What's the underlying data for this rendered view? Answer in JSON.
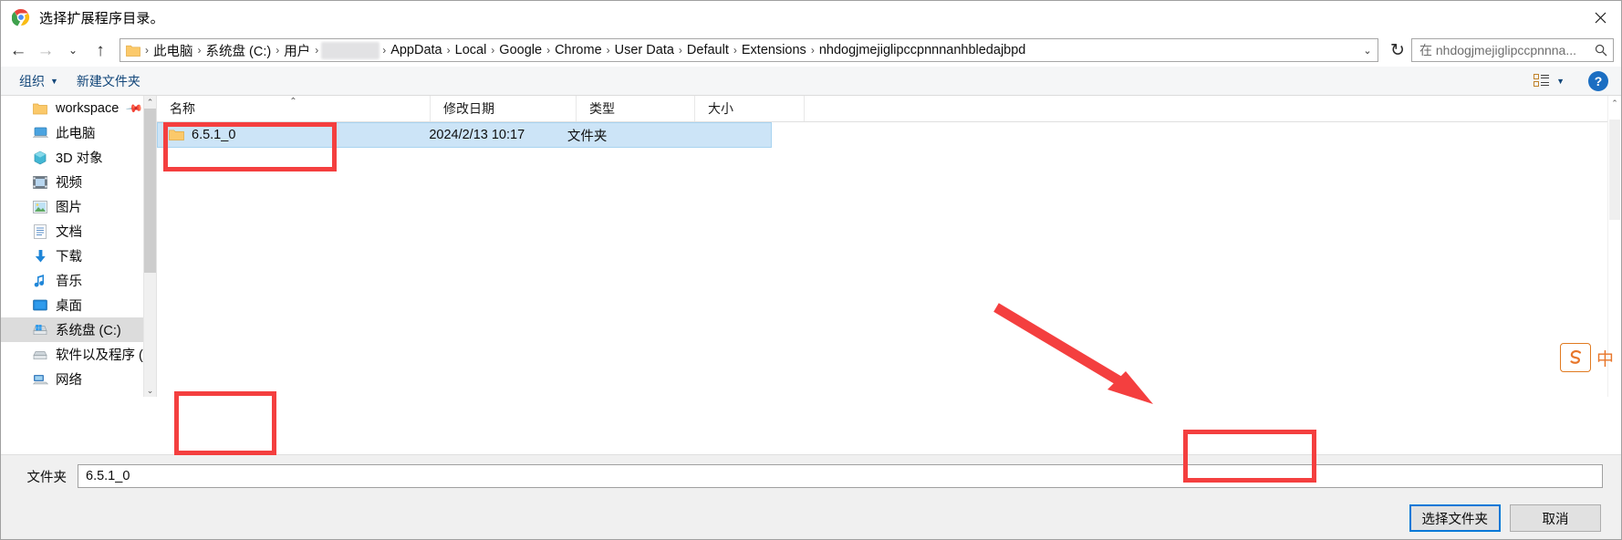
{
  "window": {
    "title": "选择扩展程序目录。",
    "app_icon": "chrome-icon",
    "close_label": "✕"
  },
  "nav": {
    "back": "←",
    "forward": "→",
    "recent": "⌄",
    "up": "↑",
    "breadcrumbs": [
      "此电脑",
      "系统盘 (C:)",
      "用户",
      "",
      "AppData",
      "Local",
      "Google",
      "Chrome",
      "User Data",
      "Default",
      "Extensions",
      "nhdogjmejiglipccpnnnanhbledajbpd"
    ],
    "dropdown": "⌄",
    "refresh": "↻",
    "search_placeholder": "在 nhdogjmejiglipccpnnna..."
  },
  "toolbar": {
    "organize": "组织",
    "organize_caret": "▼",
    "new_folder": "新建文件夹",
    "view_caret": "▼",
    "help": "?"
  },
  "sidebar": {
    "items": [
      {
        "label": "workspace",
        "icon": "folder-icon",
        "pinned": true,
        "selected": false
      },
      {
        "label": "此电脑",
        "icon": "this-pc-icon",
        "pinned": false,
        "selected": false
      },
      {
        "label": "3D 对象",
        "icon": "3d-objects-icon",
        "pinned": false,
        "selected": false
      },
      {
        "label": "视频",
        "icon": "videos-icon",
        "pinned": false,
        "selected": false
      },
      {
        "label": "图片",
        "icon": "pictures-icon",
        "pinned": false,
        "selected": false
      },
      {
        "label": "文档",
        "icon": "documents-icon",
        "pinned": false,
        "selected": false
      },
      {
        "label": "下载",
        "icon": "downloads-icon",
        "pinned": false,
        "selected": false
      },
      {
        "label": "音乐",
        "icon": "music-icon",
        "pinned": false,
        "selected": false
      },
      {
        "label": "桌面",
        "icon": "desktop-icon",
        "pinned": false,
        "selected": false
      },
      {
        "label": "系统盘 (C:)",
        "icon": "drive-icon",
        "pinned": false,
        "selected": true
      },
      {
        "label": "软件以及程序 (D",
        "icon": "drive-icon",
        "pinned": false,
        "selected": false
      },
      {
        "label": "网络",
        "icon": "network-icon",
        "pinned": false,
        "selected": false
      }
    ],
    "scroll_up": "⌃",
    "scroll_down": "⌄"
  },
  "filelist": {
    "columns": [
      {
        "label": "名称",
        "sorted": "asc",
        "sort_mark": "⌃"
      },
      {
        "label": "修改日期",
        "sorted": "",
        "sort_mark": ""
      },
      {
        "label": "类型",
        "sorted": "",
        "sort_mark": ""
      },
      {
        "label": "大小",
        "sorted": "",
        "sort_mark": ""
      }
    ],
    "rows": [
      {
        "name": "6.5.1_0",
        "date": "2024/2/13 10:17",
        "type": "文件夹",
        "size": "",
        "selected": true
      }
    ],
    "scroll_up": "⌃",
    "scroll_down": "⌄"
  },
  "footer": {
    "folder_label": "文件夹",
    "folder_value": "6.5.1_0",
    "select_button": "选择文件夹",
    "cancel_button": "取消"
  },
  "ime": {
    "logo": "S",
    "mode": "中"
  },
  "annotations": {
    "accent_color": "#f43f3f"
  }
}
